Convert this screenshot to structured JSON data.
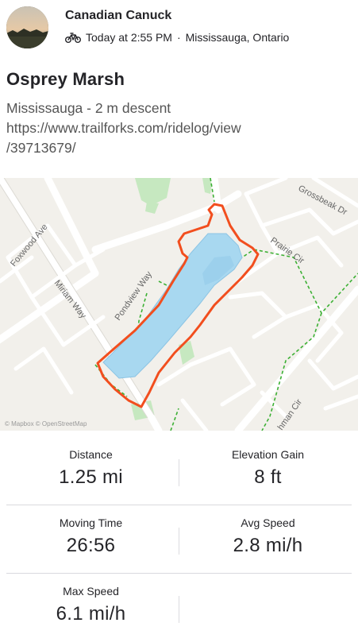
{
  "post": {
    "author": "Canadian Canuck",
    "timestamp": "Today at 2:55 PM",
    "separator": "·",
    "location": "Mississauga, Ontario",
    "activity_icon": "bike-icon"
  },
  "activity": {
    "title": "Osprey Marsh",
    "description_line1": "Mississauga - 2 m descent",
    "link_line1": "https://www.trailforks.com/ridelog/view",
    "link_line2": "/39713679/"
  },
  "map": {
    "street_labels": [
      "Grossbeak Dr",
      "Foxwood Ave",
      "Prairie Cir",
      "Miriam Way",
      "Pondview Way",
      "hman Cir"
    ],
    "attribution": "© Mapbox © OpenStreetMap",
    "route_color": "#f24e1e",
    "water_color": "#a8d8f0",
    "park_color": "#c6e8c0",
    "trail_color": "#3cb034"
  },
  "stats": {
    "distance": {
      "label": "Distance",
      "value": "1.25 mi"
    },
    "elevation": {
      "label": "Elevation Gain",
      "value": "8 ft"
    },
    "moving_time": {
      "label": "Moving Time",
      "value": "26:56"
    },
    "avg_speed": {
      "label": "Avg Speed",
      "value": "2.8 mi/h"
    },
    "max_speed": {
      "label": "Max Speed",
      "value": "6.1 mi/h"
    }
  }
}
